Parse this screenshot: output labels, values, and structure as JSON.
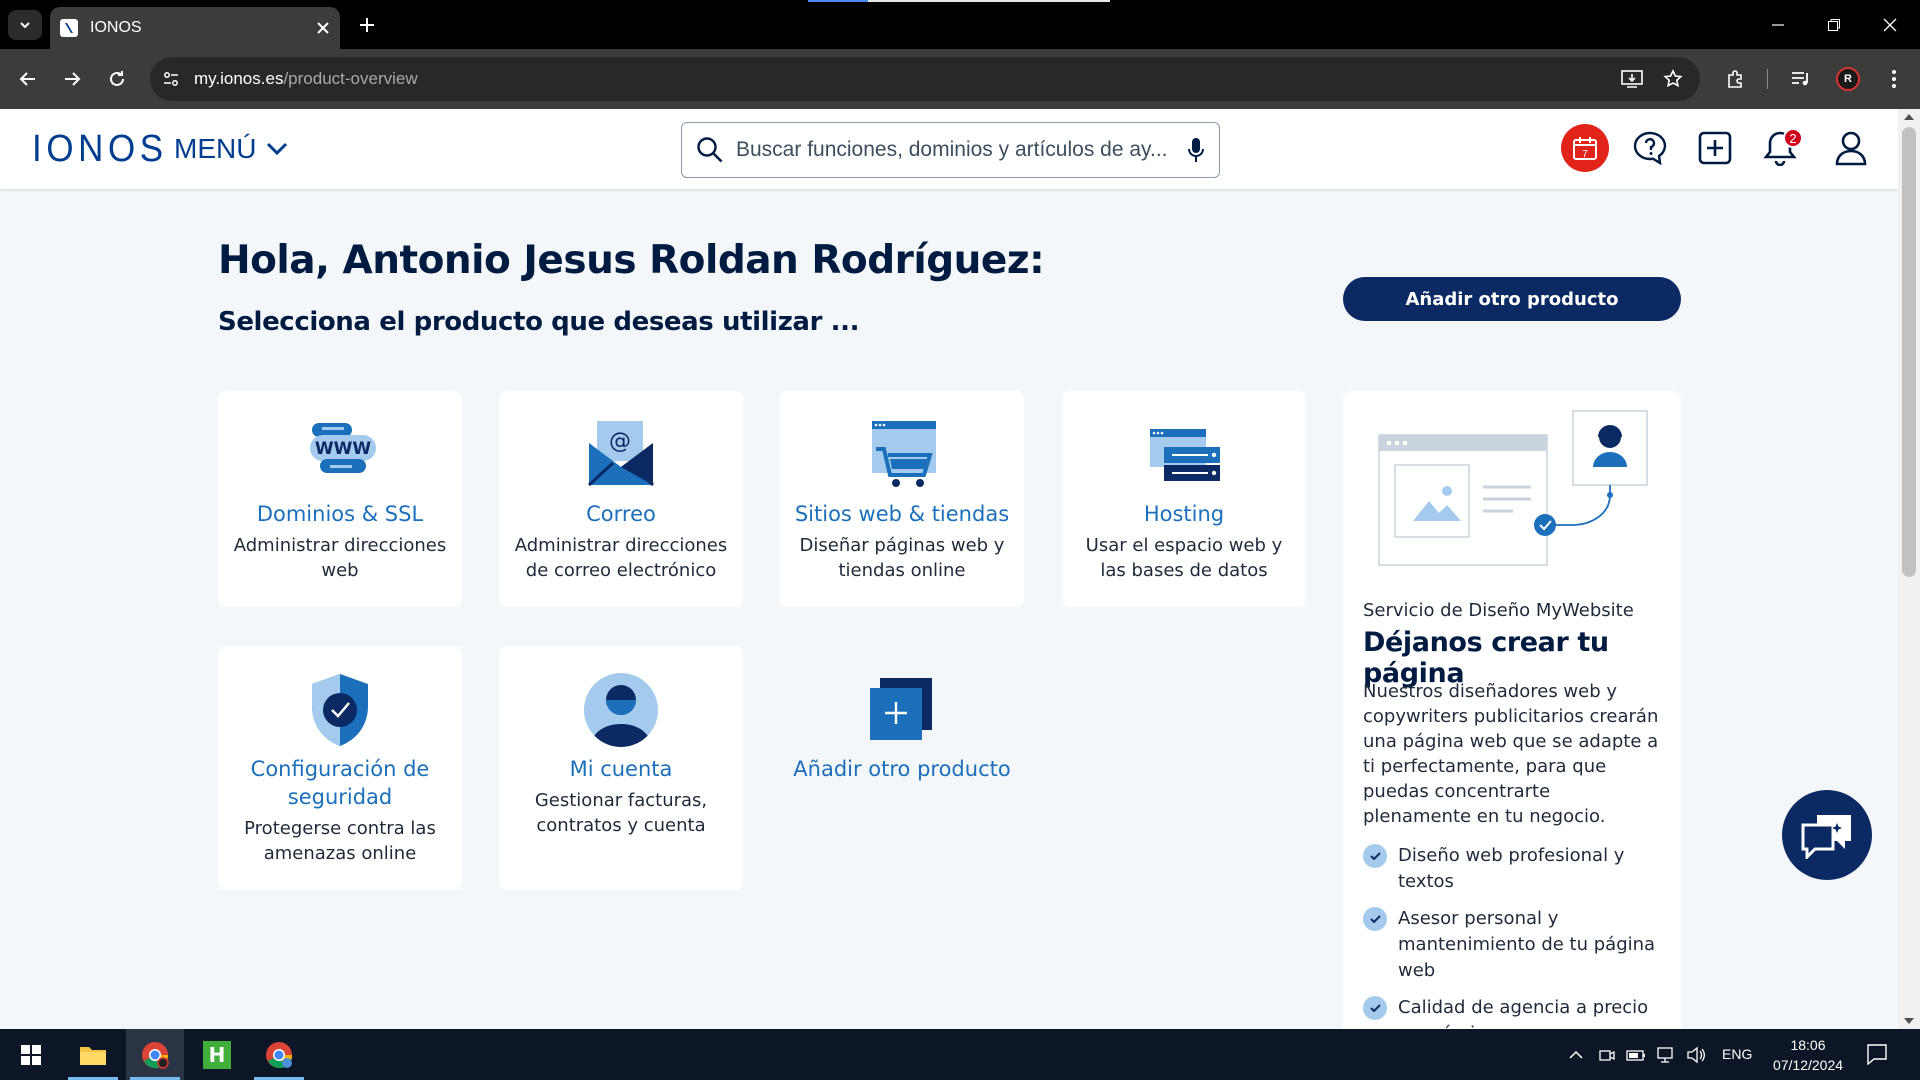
{
  "browser": {
    "tab_title": "IONOS",
    "url_host": "my.ionos.es",
    "url_path": "/product-overview"
  },
  "header": {
    "logo": "IONOS",
    "menu_label": "MENÚ",
    "search_placeholder": "Buscar funciones, dominios y artículos de ay...",
    "calendar_day": "7",
    "notifications_count": "2"
  },
  "main": {
    "greeting": "Hola, Antonio Jesus Roldan Rodríguez:",
    "subtitle": "Selecciona el producto que deseas utilizar ...",
    "add_product_button": "Añadir otro producto",
    "cards": [
      {
        "title": "Dominios & SSL",
        "desc": "Administrar direcciones web",
        "icon": "www-domain-icon"
      },
      {
        "title": "Correo",
        "desc": "Administrar direcciones de correo electrónico",
        "icon": "mail-envelope-icon"
      },
      {
        "title": "Sitios web & tiendas",
        "desc": "Diseñar páginas web y tiendas online",
        "icon": "web-shop-cart-icon"
      },
      {
        "title": "Hosting",
        "desc": "Usar el espacio web y las bases de datos",
        "icon": "server-hosting-icon"
      },
      {
        "title": "Configuración de seguridad",
        "desc": "Protegerse contra las amenazas online",
        "icon": "security-shield-icon"
      },
      {
        "title": "Mi cuenta",
        "desc": "Gestionar facturas, contratos y cuenta",
        "icon": "account-user-icon"
      },
      {
        "title": "Añadir otro producto",
        "desc": "",
        "icon": "add-product-plus-icon"
      }
    ]
  },
  "promo": {
    "kicker": "Servicio de Diseño MyWebsite",
    "title": "Déjanos crear tu página",
    "body": "Nuestros diseñadores web y copywriters publicitarios crearán una página web que se adapte a ti perfectamente, para que puedas concentrarte plenamente en tu negocio.",
    "features": [
      "Diseño web profesional y textos",
      "Asesor personal y mantenimiento de tu página web",
      "Calidad de agencia a precio económico"
    ]
  },
  "taskbar": {
    "lang": "ENG",
    "time": "18:06",
    "date": "07/12/2024"
  },
  "colors": {
    "brand": "#003d8f",
    "primary_button": "#0b2a63",
    "link_blue": "#1b6fbb",
    "calendar_red": "#e2231a"
  }
}
